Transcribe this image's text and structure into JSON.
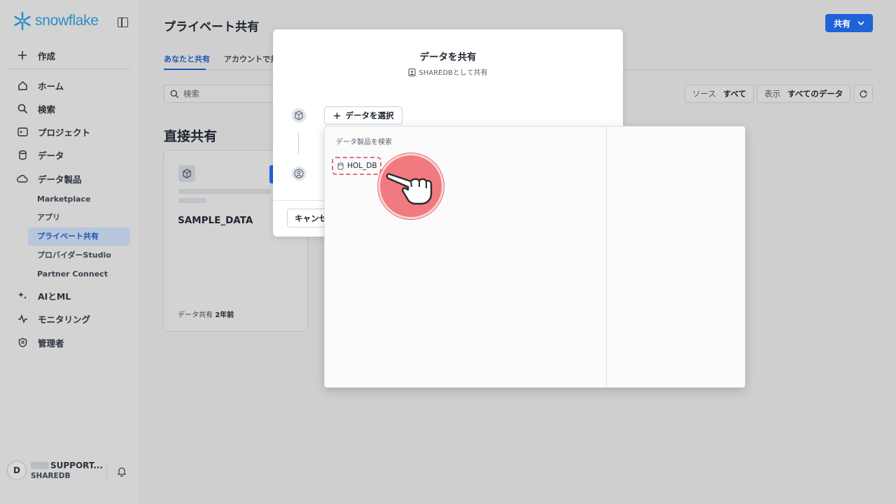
{
  "sidebar": {
    "logo_text": "snowflake",
    "create_label": "作成",
    "nav": {
      "home": "ホーム",
      "search": "検索",
      "projects": "プロジェクト",
      "data": "データ",
      "data_products": "データ製品",
      "ai_ml": "AIとML",
      "monitoring": "モニタリング",
      "admin": "管理者"
    },
    "sub": {
      "marketplace": "Marketplace",
      "apps": "アプリ",
      "private_sharing": "プライベート共有",
      "provider_studio": "プロバイダーStudio",
      "partner_connect": "Partner Connect"
    },
    "user": {
      "initial": "D",
      "name": "SUPPORT...",
      "account": "SHAREDB"
    }
  },
  "header": {
    "title": "プライベート共有",
    "share_button": "共有"
  },
  "tabs": [
    "あなたと共有",
    "アカウントで共有"
  ],
  "toolbar": {
    "search_placeholder": "検索",
    "source_key": "ソース",
    "source_value": "すべて",
    "display_key": "表示",
    "display_value": "すべてのデータ"
  },
  "section_title": "直接共有",
  "card": {
    "title": "SAMPLE_DATA",
    "footer_label": "データ共有",
    "footer_value": "2年前"
  },
  "modal": {
    "title": "データを共有",
    "subtitle": "SHAREDBとして共有",
    "select_button": "データを選択",
    "cancel_button": "キャンセ"
  },
  "dropdown": {
    "search_placeholder": "データ製品を検索",
    "items": [
      "HOL_DB"
    ]
  },
  "colors": {
    "primary": "#1f63d8",
    "logo": "#2a8fc5",
    "highlight": "#e07178"
  }
}
